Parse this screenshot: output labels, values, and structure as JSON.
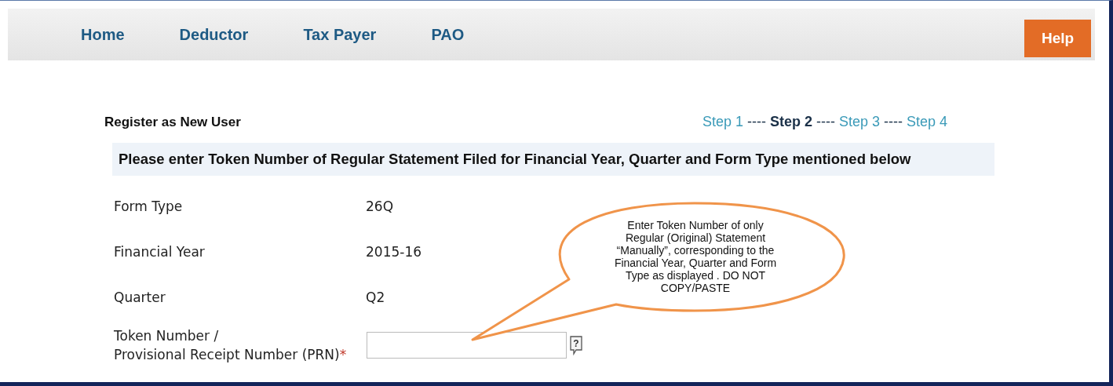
{
  "nav": {
    "items": [
      {
        "label": "Home"
      },
      {
        "label": "Deductor"
      },
      {
        "label": "Tax Payer"
      },
      {
        "label": "PAO"
      }
    ],
    "help": "Help"
  },
  "page_title": "Register as New User",
  "steps": {
    "items": [
      {
        "label": "Step 1",
        "selected": false
      },
      {
        "label": "Step 2",
        "selected": true
      },
      {
        "label": "Step 3",
        "selected": false
      },
      {
        "label": "Step 4",
        "selected": false
      }
    ],
    "separators": [
      "----",
      "----",
      "----"
    ]
  },
  "instruction": "Please enter Token Number of Regular Statement Filed for Financial Year, Quarter and Form Type mentioned below",
  "fields": [
    {
      "label": "Form Type",
      "value": "26Q"
    },
    {
      "label": "Financial Year",
      "value": "2015-16"
    },
    {
      "label": "Quarter",
      "value": "Q2"
    }
  ],
  "token_field": {
    "label_lines": [
      "Token Number /",
      "Provisional Receipt Number (PRN)"
    ],
    "required_mark": "*",
    "help_icon": "?"
  },
  "callout": {
    "text": "Enter Token Number of only Regular (Original) Statement “Manually”, corresponding to the Financial Year, Quarter and Form Type as displayed . DO NOT COPY/PASTE"
  }
}
